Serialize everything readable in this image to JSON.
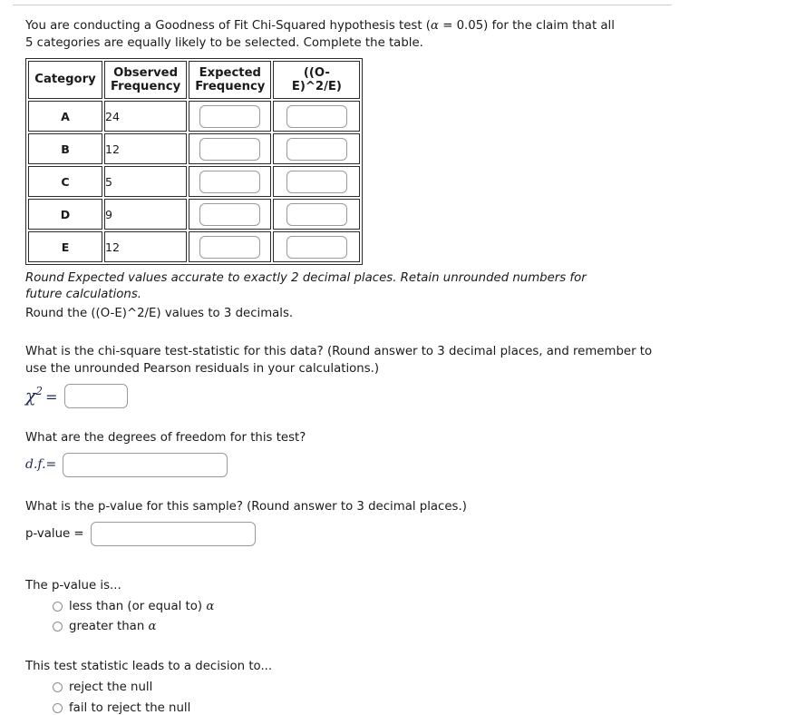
{
  "intro": {
    "text": "You are conducting a Goodness of Fit Chi-Squared hypothesis test (α = 0.05) for the claim that all 5 categories are equally likely to be selected. Complete the table."
  },
  "table": {
    "headers": [
      "Category",
      "Observed Frequency",
      "Expected Frequency",
      "((O-E)^2/E)"
    ],
    "rows": [
      {
        "category": "A",
        "observed": "24",
        "expected": "",
        "contribution": ""
      },
      {
        "category": "B",
        "observed": "12",
        "expected": "",
        "contribution": ""
      },
      {
        "category": "C",
        "observed": "5",
        "expected": "",
        "contribution": ""
      },
      {
        "category": "D",
        "observed": "9",
        "expected": "",
        "contribution": ""
      },
      {
        "category": "E",
        "observed": "12",
        "expected": "",
        "contribution": ""
      }
    ]
  },
  "notes": {
    "rounding_italic": "Round Expected values accurate to exactly 2 decimal places. Retain unrounded numbers for future calculations.",
    "rounding_plain": "Round the ((O-E)^2/E) values to 3 decimals."
  },
  "chi_square": {
    "question": "What is the chi-square test-statistic for this data? (Round answer to 3 decimal places, and remember to use the unrounded Pearson residuals in your calculations.)",
    "label_symbol": "χ",
    "label_exponent": "2",
    "label_equals": "=",
    "value": ""
  },
  "degrees_of_freedom": {
    "question": "What are the degrees of freedom for this test?",
    "label": "d.f.=",
    "value": ""
  },
  "p_value": {
    "question": "What is the p-value for this sample? (Round answer to 3 decimal places.)",
    "label": "p-value =",
    "value": ""
  },
  "p_value_comparison": {
    "title": "The p-value is...",
    "options": [
      {
        "label": "less than (or equal to) α",
        "selected": false
      },
      {
        "label": "greater than α",
        "selected": false
      }
    ]
  },
  "decision": {
    "title": "This test statistic leads to a decision to...",
    "options": [
      {
        "label": "reject the null",
        "selected": false
      },
      {
        "label": "fail to reject the null",
        "selected": false
      }
    ]
  },
  "colors": {
    "text": "#1a1a1a",
    "math_label": "#1a2a52",
    "table_border": "#2b2b2b",
    "input_border": "#9a9a9a",
    "rule": "#cfcfcf"
  }
}
